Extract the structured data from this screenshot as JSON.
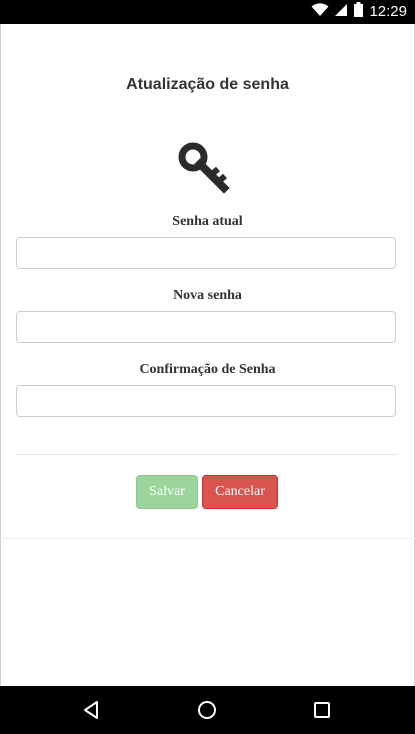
{
  "status_bar": {
    "time": "12:29",
    "icons": [
      "wifi-icon",
      "cell-signal-icon",
      "battery-icon"
    ]
  },
  "page": {
    "title": "Atualização de senha",
    "icon": "key-icon"
  },
  "form": {
    "current_password": {
      "label": "Senha atual",
      "value": "",
      "placeholder": ""
    },
    "new_password": {
      "label": "Nova senha",
      "value": "",
      "placeholder": ""
    },
    "confirm_password": {
      "label": "Confirmação de Senha",
      "value": "",
      "placeholder": ""
    }
  },
  "actions": {
    "save_label": "Salvar",
    "cancel_label": "Cancelar"
  },
  "navigation_bar": {
    "icons": [
      "back-icon",
      "home-icon",
      "recents-icon"
    ]
  },
  "colors": {
    "save_button": "#9bd59c",
    "cancel_button": "#d9534f",
    "title_text": "#333333",
    "status_bar": "#000000",
    "nav_bar": "#000000"
  }
}
